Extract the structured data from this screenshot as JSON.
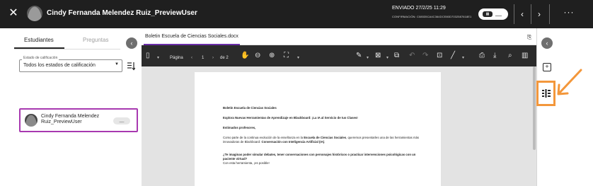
{
  "header": {
    "user_name": "Cindy Fernanda Melendez Ruiz_PreviewUser",
    "sent_label": "ENVIADO 27/2/25 11:29",
    "confirmation": "CONFIRMACIÓN: C08535CA4C364DCE80D7032587618E1",
    "grade_value": "__",
    "icons": [
      "close-icon",
      "avatar",
      "grade-icon",
      "chevron-left-icon",
      "chevron-right-icon",
      "more-icon"
    ]
  },
  "left_panel": {
    "tabs": [
      {
        "label": "Estudiantes",
        "active": true
      },
      {
        "label": "Preguntas",
        "active": false
      }
    ],
    "filter": {
      "label": "Estado de calificación",
      "value": "Todos los estados de calificación"
    },
    "students": [
      {
        "name": "Cindy Fernanda Melendez Ruiz_PreviewUser",
        "grade": "__",
        "selected": true
      }
    ]
  },
  "document": {
    "tab_label": "Boletin Escuela de Ciencias Sociales.docx",
    "toolbar": {
      "page_label": "Página",
      "current_page": "1",
      "page_total": "de 2"
    },
    "content": {
      "title": "Boletín Escuela de Ciencias Sociales",
      "subtitle": "Explora Nuevas Herramientas de Aprendizaje en Blackboard: ¡La IA al Servicio de tus Clases!",
      "greeting": "Estimados profesores,",
      "p1_a": "Como parte de la continua evolución de la enseñanza en la ",
      "p1_bold1": "Escuela de Ciencias Sociales",
      "p1_b": ", queremos presentarles una de las herramientas más innovadoras de Blackboard: ",
      "p1_bold2": "Conversación con Inteligencia Artificial (IA)",
      "p1_c": ".",
      "question": "¿Te imaginas poder simular debates, tener conversaciones con personajes históricos o practicar intervenciones psicológicas con un paciente virtual?",
      "closing": "Con esta herramienta, ¡es posible!"
    }
  },
  "colors": {
    "header_bg": "#1f1f1f",
    "selected_border": "#a839b0",
    "tab_accent": "#6b2ea8",
    "highlight": "#f3973b",
    "toolbar_bg": "#2b2b2b",
    "viewer_bg": "#e3e3e3"
  }
}
